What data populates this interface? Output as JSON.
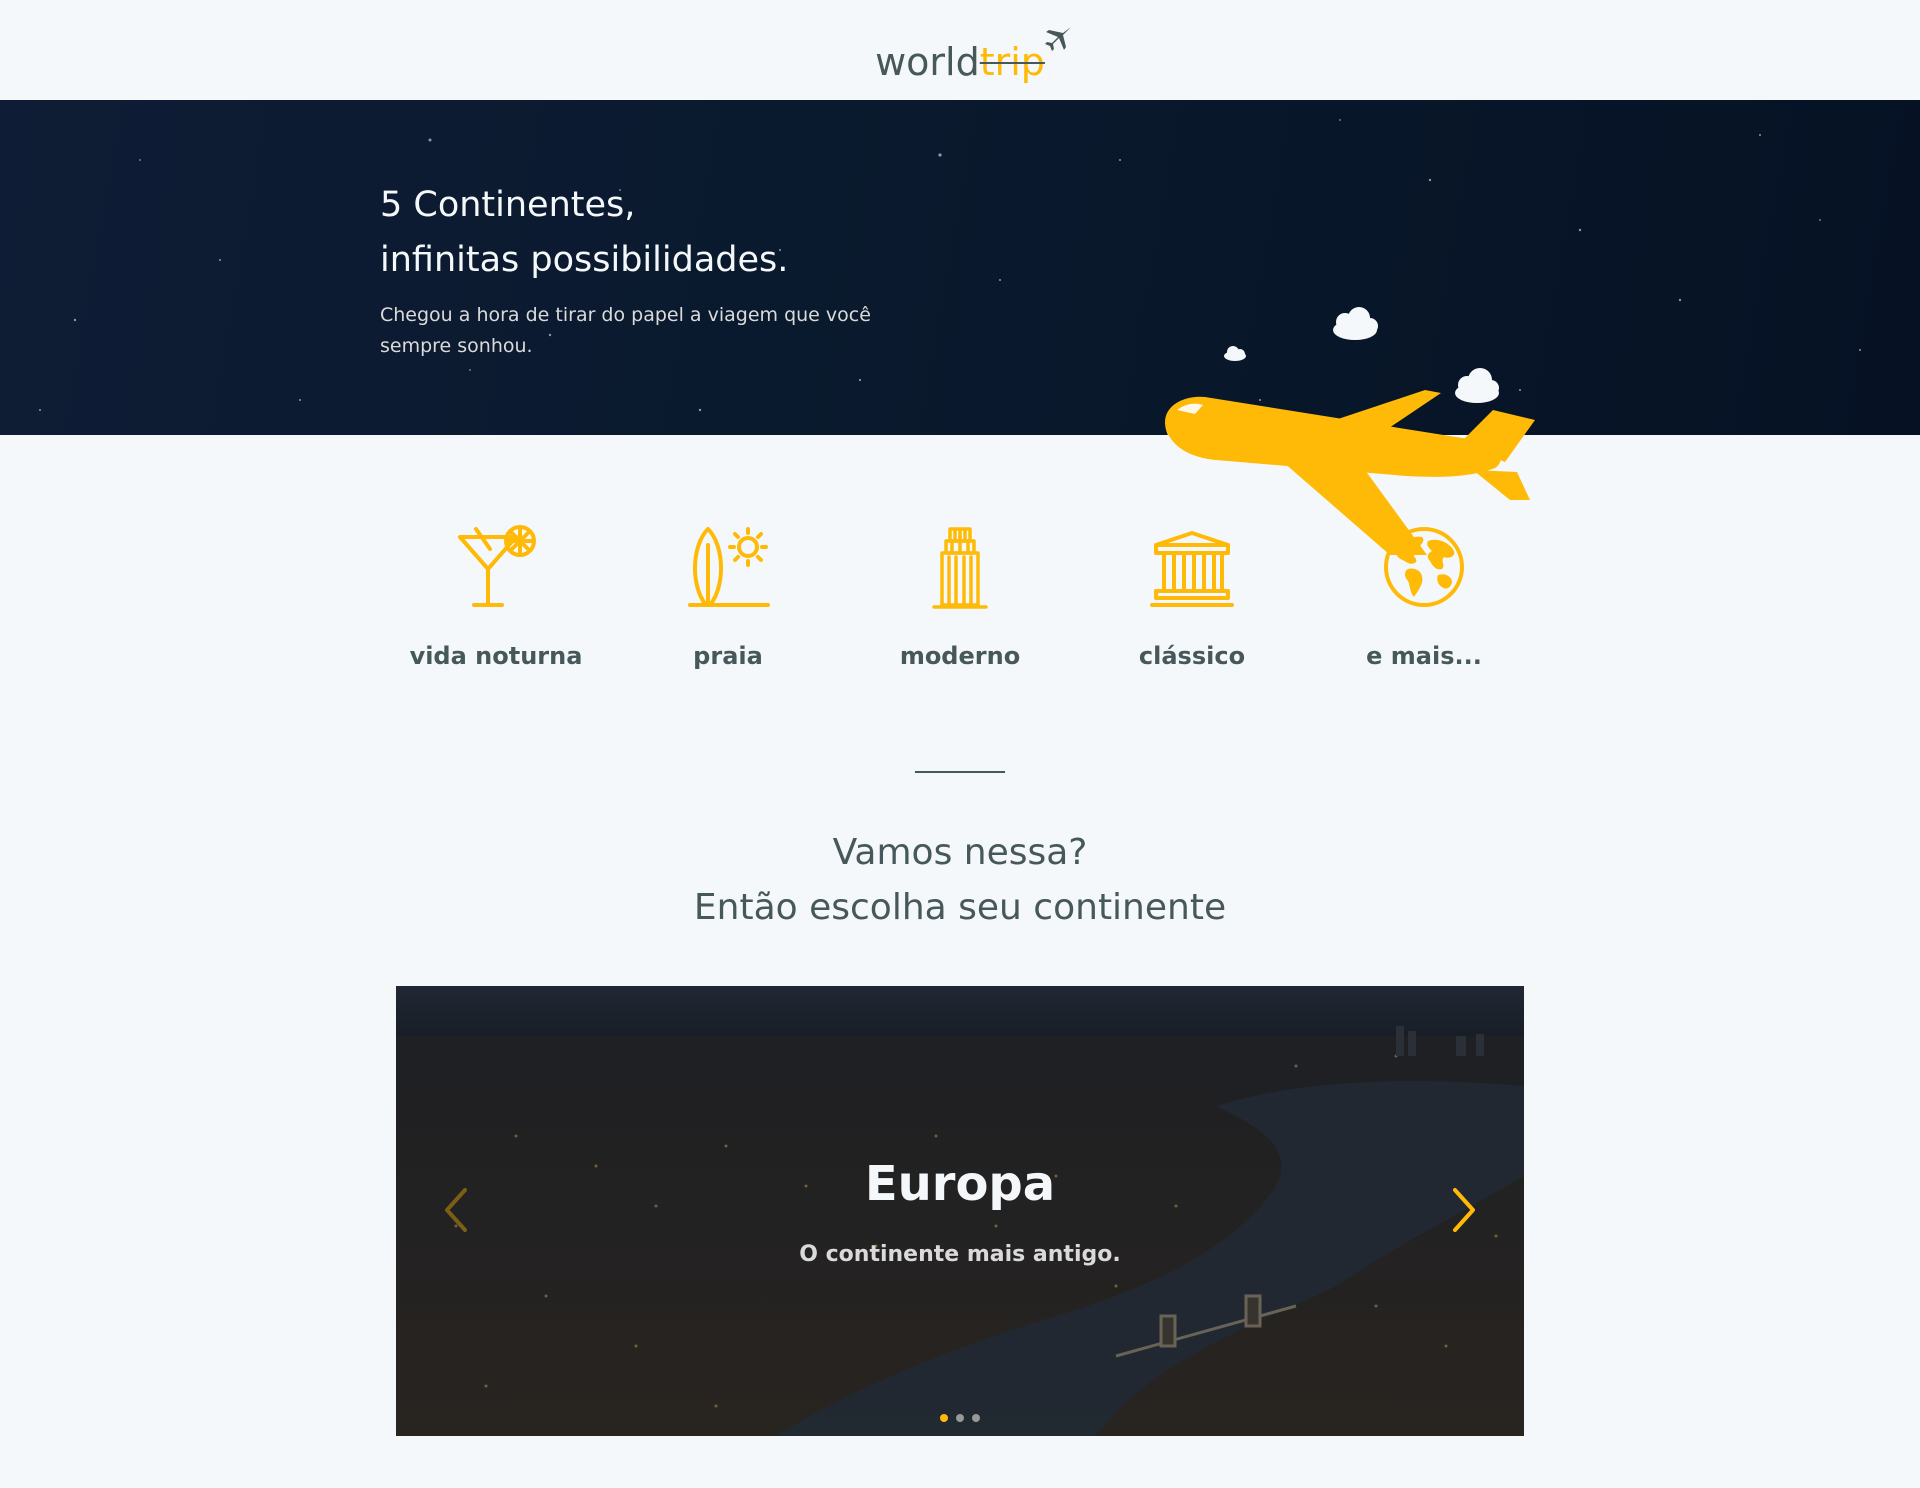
{
  "header": {
    "logo_world": "world",
    "logo_trip": "trip"
  },
  "hero": {
    "title_line1": "5 Continentes,",
    "title_line2": "infinitas possibilidades.",
    "subtitle": "Chegou a hora de tirar do papel a viagem que você sempre sonhou."
  },
  "travel_types": [
    {
      "label": "vida noturna",
      "icon": "cocktail-icon"
    },
    {
      "label": "praia",
      "icon": "surfboard-sun-icon"
    },
    {
      "label": "moderno",
      "icon": "skyscraper-icon"
    },
    {
      "label": "clássico",
      "icon": "museum-icon"
    },
    {
      "label": "e mais...",
      "icon": "globe-icon"
    }
  ],
  "cta": {
    "line1": "Vamos nessa?",
    "line2": "Então escolha seu continente"
  },
  "slider": {
    "title": "Europa",
    "subtitle": "O continente mais antigo.",
    "active_index": 0,
    "total_slides": 3
  },
  "colors": {
    "accent": "#ffba08",
    "text_dark": "#47585b",
    "hero_bg": "#0a1a2e",
    "page_bg": "#f5f8fa"
  }
}
